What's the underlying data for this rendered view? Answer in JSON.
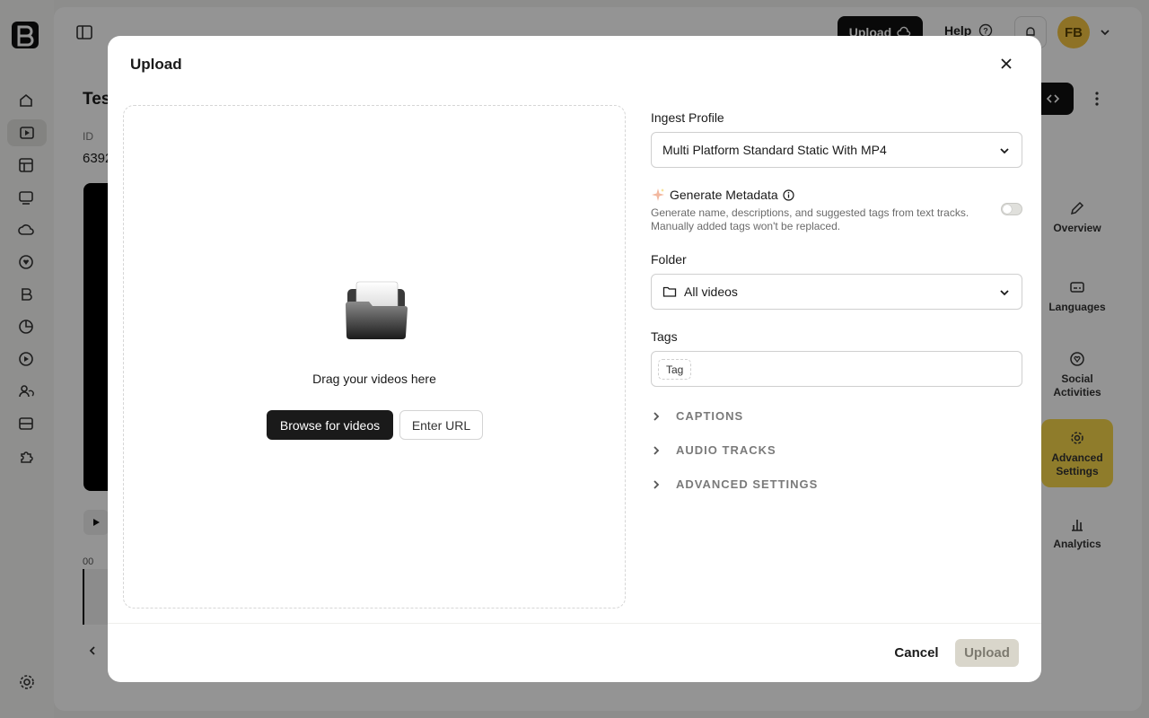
{
  "background": {
    "header": {
      "upload_label": "Upload",
      "help_label": "Help",
      "avatar_initials": "FB"
    },
    "content": {
      "title_fragment": "Tes",
      "id_label": "ID",
      "id_value_fragment": "6392",
      "time_fragment": "00"
    },
    "side_tabs": [
      {
        "label": "Overview",
        "icon": "pencil-icon"
      },
      {
        "label": "Languages",
        "icon": "subtitles-icon"
      },
      {
        "label": "Social Activities",
        "icon": "heart-badge-icon"
      },
      {
        "label": "Advanced Settings",
        "icon": "gear-icon",
        "active": true
      },
      {
        "label": "Analytics",
        "icon": "bar-chart-icon"
      }
    ],
    "colors": {
      "accent": "#f7d64a",
      "avatar": "#f4c542"
    }
  },
  "modal": {
    "title": "Upload",
    "dropzone": {
      "text": "Drag your videos here",
      "browse_label": "Browse for videos",
      "url_label": "Enter URL"
    },
    "ingest_profile": {
      "label": "Ingest Profile",
      "value": "Multi Platform Standard Static With MP4"
    },
    "generate_metadata": {
      "label": "Generate Metadata",
      "description_line1": "Generate name, descriptions, and suggested tags from text tracks.",
      "description_line2": "Manually added tags won't be replaced.",
      "enabled": false
    },
    "folder": {
      "label": "Folder",
      "value": "All videos"
    },
    "tags": {
      "label": "Tags",
      "chip_placeholder": "Tag"
    },
    "sections": [
      {
        "label": "CAPTIONS"
      },
      {
        "label": "AUDIO TRACKS"
      },
      {
        "label": "ADVANCED SETTINGS"
      }
    ],
    "footer": {
      "cancel_label": "Cancel",
      "upload_label": "Upload"
    }
  }
}
